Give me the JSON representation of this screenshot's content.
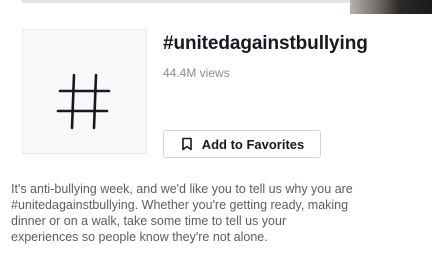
{
  "hashtag": {
    "symbol": "#",
    "title": "#unitedagainstbullying",
    "views": "44.4M views"
  },
  "actions": {
    "favorites_label": "Add to Favorites",
    "favorites_icon": "bookmark-icon"
  },
  "description": {
    "lines": [
      "It's anti-bullying week, and we'd like you to tell us why you are",
      "#unitedagainstbullying. Whether you're getting ready, making",
      "dinner or on a walk, take some time to tell us your",
      "experiences so people know they're not alone."
    ]
  },
  "colors": {
    "text_primary": "#161823",
    "text_secondary": "#8a8b91",
    "description_text": "#5c5d62",
    "hash_box_bg": "#f8f8f8",
    "button_border": "#d4d4d6"
  }
}
